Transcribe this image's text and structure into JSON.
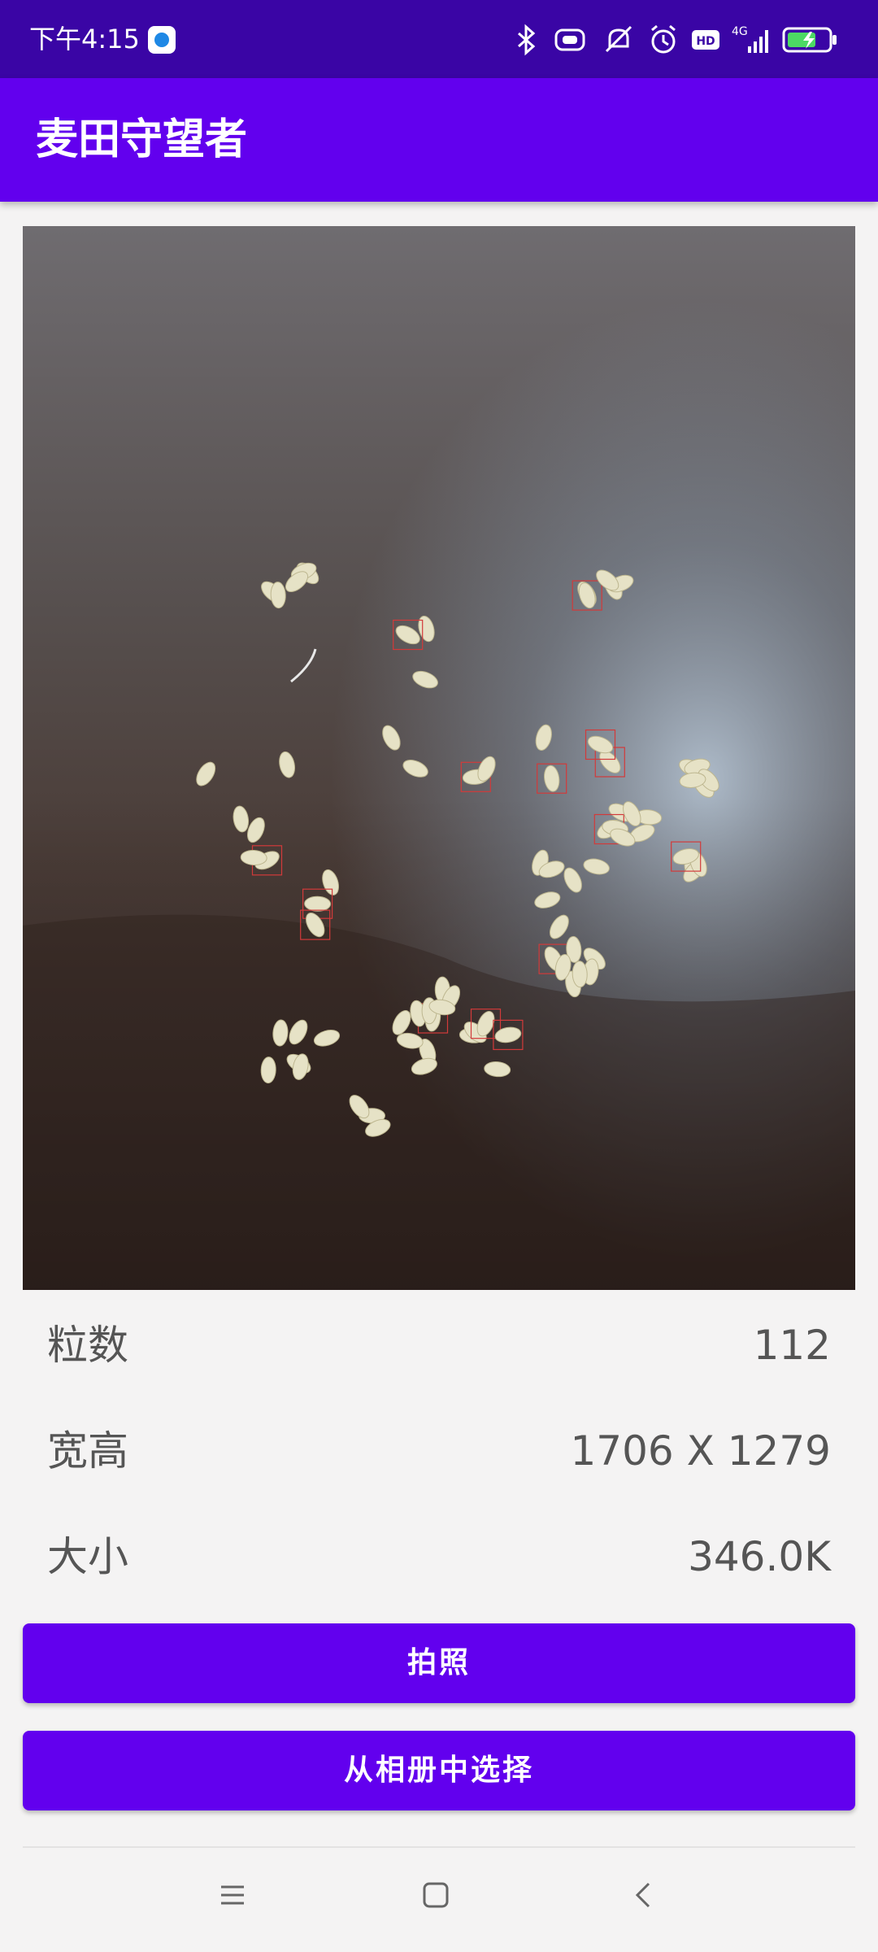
{
  "status_bar": {
    "time": "下午4:15",
    "network_type": "4G",
    "hd_badge": "HD",
    "icons": [
      "bluetooth-icon",
      "vibrate-icon",
      "mute-icon",
      "alarm-icon",
      "hd-icon",
      "signal-icon",
      "battery-charging-icon"
    ]
  },
  "app_bar": {
    "title": "麦田守望者"
  },
  "photo": {
    "content": "wheat-grain-detection-photo"
  },
  "info": {
    "count_label": "粒数",
    "count_value": "112",
    "dimensions_label": "宽高",
    "dimensions_value": "1706 X 1279",
    "size_label": "大小",
    "size_value": "346.0K"
  },
  "buttons": {
    "take_photo": "拍照",
    "choose_from_album": "从相册中选择"
  },
  "nav_bar": {
    "items": [
      "menu-icon",
      "home-icon",
      "back-icon"
    ]
  },
  "colors": {
    "status_bar": "#3a05a5",
    "primary": "#6200ee",
    "background": "#f4f3f3",
    "label_text": "#555555"
  }
}
